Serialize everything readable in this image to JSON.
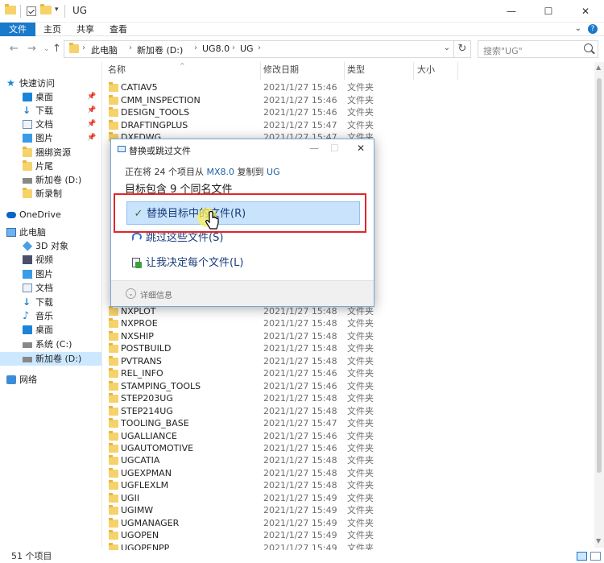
{
  "window": {
    "title": "UG",
    "minimize_glyph": "—",
    "maximize_glyph": "☐",
    "close_glyph": "✕"
  },
  "menubar": {
    "items": [
      "文件",
      "主页",
      "共享",
      "查看"
    ]
  },
  "address": {
    "crumbs": [
      "此电脑",
      "新加卷 (D:)",
      "UG8.0",
      "UG"
    ],
    "search_placeholder": "搜索\"UG\""
  },
  "sidebar": {
    "items": [
      {
        "label": "快速访问",
        "icon": "star-icon"
      },
      {
        "label": "桌面",
        "icon": "desktop-icon",
        "pinned": true
      },
      {
        "label": "下载",
        "icon": "download-icon",
        "pinned": true
      },
      {
        "label": "文档",
        "icon": "document-icon",
        "pinned": true
      },
      {
        "label": "图片",
        "icon": "picture-icon",
        "pinned": true
      },
      {
        "label": "捆绑资源",
        "icon": "folder-icon"
      },
      {
        "label": "片尾",
        "icon": "folder-icon"
      },
      {
        "label": "新加卷 (D:)",
        "icon": "drive-icon"
      },
      {
        "label": "新录制",
        "icon": "folder-icon"
      },
      {
        "label": "OneDrive",
        "icon": "cloud-icon"
      },
      {
        "label": "此电脑",
        "icon": "computer-icon"
      },
      {
        "label": "3D 对象",
        "icon": "cube-icon"
      },
      {
        "label": "视频",
        "icon": "video-icon"
      },
      {
        "label": "图片",
        "icon": "picture-icon"
      },
      {
        "label": "文档",
        "icon": "document-icon"
      },
      {
        "label": "下载",
        "icon": "download-icon"
      },
      {
        "label": "音乐",
        "icon": "music-icon"
      },
      {
        "label": "桌面",
        "icon": "desktop-icon"
      },
      {
        "label": "系统 (C:)",
        "icon": "drive-icon"
      },
      {
        "label": "新加卷 (D:)",
        "icon": "drive-icon",
        "selected": true
      },
      {
        "label": "网络",
        "icon": "network-icon"
      }
    ]
  },
  "columns": [
    "名称",
    "修改日期",
    "类型",
    "大小"
  ],
  "files_top": [
    {
      "name": "CATIAV5",
      "date": "2021/1/27 15:46",
      "type": "文件夹"
    },
    {
      "name": "CMM_INSPECTION",
      "date": "2021/1/27 15:46",
      "type": "文件夹"
    },
    {
      "name": "DESIGN_TOOLS",
      "date": "2021/1/27 15:46",
      "type": "文件夹"
    },
    {
      "name": "DRAFTINGPLUS",
      "date": "2021/1/27 15:47",
      "type": "文件夹"
    },
    {
      "name": "DXFDWG",
      "date": "2021/1/27 15:47",
      "type": "文件夹"
    }
  ],
  "files_bottom": [
    {
      "name": "NXPLOT",
      "date": "2021/1/27 15:48",
      "type": "文件夹"
    },
    {
      "name": "NXPROE",
      "date": "2021/1/27 15:48",
      "type": "文件夹"
    },
    {
      "name": "NXSHIP",
      "date": "2021/1/27 15:48",
      "type": "文件夹"
    },
    {
      "name": "POSTBUILD",
      "date": "2021/1/27 15:48",
      "type": "文件夹"
    },
    {
      "name": "PVTRANS",
      "date": "2021/1/27 15:48",
      "type": "文件夹"
    },
    {
      "name": "REL_INFO",
      "date": "2021/1/27 15:46",
      "type": "文件夹"
    },
    {
      "name": "STAMPING_TOOLS",
      "date": "2021/1/27 15:46",
      "type": "文件夹"
    },
    {
      "name": "STEP203UG",
      "date": "2021/1/27 15:48",
      "type": "文件夹"
    },
    {
      "name": "STEP214UG",
      "date": "2021/1/27 15:48",
      "type": "文件夹"
    },
    {
      "name": "TOOLING_BASE",
      "date": "2021/1/27 15:47",
      "type": "文件夹"
    },
    {
      "name": "UGALLIANCE",
      "date": "2021/1/27 15:46",
      "type": "文件夹"
    },
    {
      "name": "UGAUTOMOTIVE",
      "date": "2021/1/27 15:46",
      "type": "文件夹"
    },
    {
      "name": "UGCATIA",
      "date": "2021/1/27 15:48",
      "type": "文件夹"
    },
    {
      "name": "UGEXPMAN",
      "date": "2021/1/27 15:48",
      "type": "文件夹"
    },
    {
      "name": "UGFLEXLM",
      "date": "2021/1/27 15:48",
      "type": "文件夹"
    },
    {
      "name": "UGII",
      "date": "2021/1/27 15:49",
      "type": "文件夹"
    },
    {
      "name": "UGIMW",
      "date": "2021/1/27 15:49",
      "type": "文件夹"
    },
    {
      "name": "UGMANAGER",
      "date": "2021/1/27 15:49",
      "type": "文件夹"
    },
    {
      "name": "UGOPEN",
      "date": "2021/1/27 15:49",
      "type": "文件夹"
    },
    {
      "name": "UGOPENPP",
      "date": "2021/1/27 15:49",
      "type": "文件夹"
    }
  ],
  "status": {
    "count": "51 个项目"
  },
  "dialog": {
    "title": "替换或跳过文件",
    "line_prefix": "正在将 24 个项目从",
    "from": "MX8.0",
    "mid": "复制到",
    "to": "UG",
    "heading": "目标包含 9 个同名文件",
    "options": [
      {
        "label": "替换目标中的文件(R)",
        "icon": "check-icon"
      },
      {
        "label": "跳过这些文件(S)",
        "icon": "skip-icon"
      },
      {
        "label": "让我决定每个文件(L)",
        "icon": "decide-icon"
      }
    ],
    "details": "详细信息"
  },
  "colors": {
    "accent": "#1979ca",
    "selection": "#cce8ff",
    "highlight_box": "#e0262a"
  }
}
